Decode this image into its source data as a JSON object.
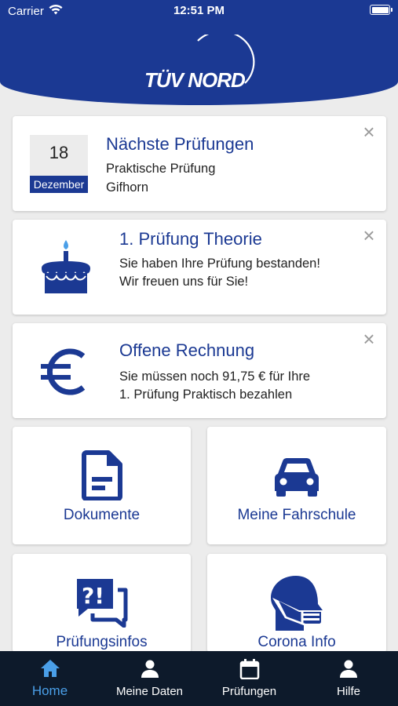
{
  "status_bar": {
    "carrier": "Carrier",
    "time": "12:51 PM"
  },
  "brand": {
    "logo_text": "TÜV NORD",
    "primary_color": "#1b3993",
    "accent_color": "#4a9fe8"
  },
  "cards": {
    "next_exam": {
      "title": "Nächste Prüfungen",
      "line1": "Praktische Prüfung",
      "line2": "Gifhorn",
      "calendar_day": "18",
      "calendar_month": "Dezember",
      "icon": "calendar-icon"
    },
    "theory": {
      "title": "1. Prüfung Theorie",
      "text": "Sie haben Ihre Prüfung bestanden! Wir freuen uns für Sie!",
      "icon": "cake-icon"
    },
    "invoice": {
      "title": "Offene Rechnung",
      "line1": "Sie müssen noch 91,75 € für Ihre",
      "line2": "1. Prüfung Praktisch bezahlen",
      "icon": "euro-icon"
    }
  },
  "tiles": {
    "documents": {
      "label": "Dokumente",
      "icon": "document-icon"
    },
    "driving_school": {
      "label": "Meine Fahrschule",
      "icon": "car-icon"
    },
    "exam_info": {
      "label": "Prüfungsinfos",
      "icon": "question-chat-icon"
    },
    "corona": {
      "label": "Corona Info",
      "icon": "mask-head-icon"
    }
  },
  "tabs": {
    "home": {
      "label": "Home",
      "icon": "home-icon",
      "active": true
    },
    "my_data": {
      "label": "Meine Daten",
      "icon": "person-icon"
    },
    "exams": {
      "label": "Prüfungen",
      "icon": "calendar-icon"
    },
    "help": {
      "label": "Hilfe",
      "icon": "person-icon"
    }
  }
}
